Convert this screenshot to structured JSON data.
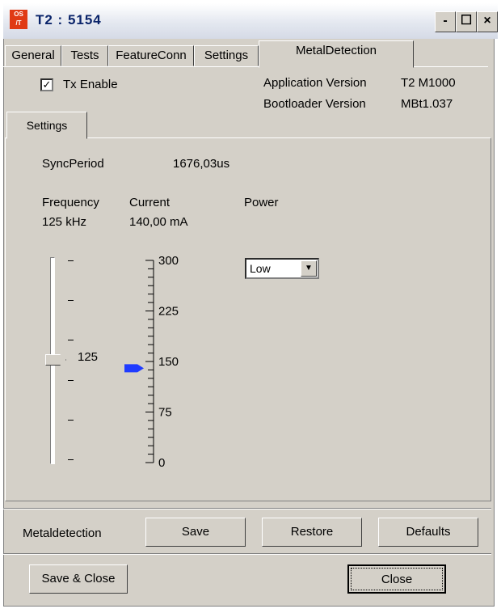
{
  "window": {
    "title": "T2 : 5154",
    "app_icon_text": [
      "OS",
      "/T"
    ],
    "minimize_glyph": "-",
    "maximize_glyph": "☐",
    "close_glyph": "×"
  },
  "tabs": [
    {
      "label": "General",
      "active": false
    },
    {
      "label": "Tests",
      "active": false
    },
    {
      "label": "FeatureConn",
      "active": false
    },
    {
      "label": "Settings",
      "active": false
    },
    {
      "label": "MetalDetection",
      "active": true
    }
  ],
  "tx_enable": {
    "label": "Tx Enable",
    "checked": true,
    "check_glyph": "✓"
  },
  "versions": {
    "app_label": "Application Version",
    "app_value": "T2 M1000",
    "boot_label": "Bootloader Version",
    "boot_value": "MBt1.037"
  },
  "inner_tab": {
    "label": "Settings"
  },
  "sync": {
    "label": "SyncPeriod",
    "value": "1676,03us"
  },
  "frequency": {
    "label": "Frequency",
    "value": "125 kHz",
    "slider_value_label": "125",
    "slider_level": 0.5,
    "slider_ticks": [
      "-",
      "-",
      "-",
      "-",
      "-",
      "-"
    ]
  },
  "current": {
    "label": "Current",
    "value": "140,00 mA",
    "scale_max": 300,
    "scale_labels": [
      "300",
      "225",
      "150",
      "75",
      "0"
    ],
    "indicator_value": 140
  },
  "power": {
    "label": "Power",
    "selected": "Low",
    "dropdown_glyph": "▼"
  },
  "metaldetection_bar": {
    "label": "Metaldetection",
    "save": "Save",
    "restore": "Restore",
    "defaults": "Defaults"
  },
  "footer": {
    "save_close": "Save & Close",
    "close": "Close"
  }
}
